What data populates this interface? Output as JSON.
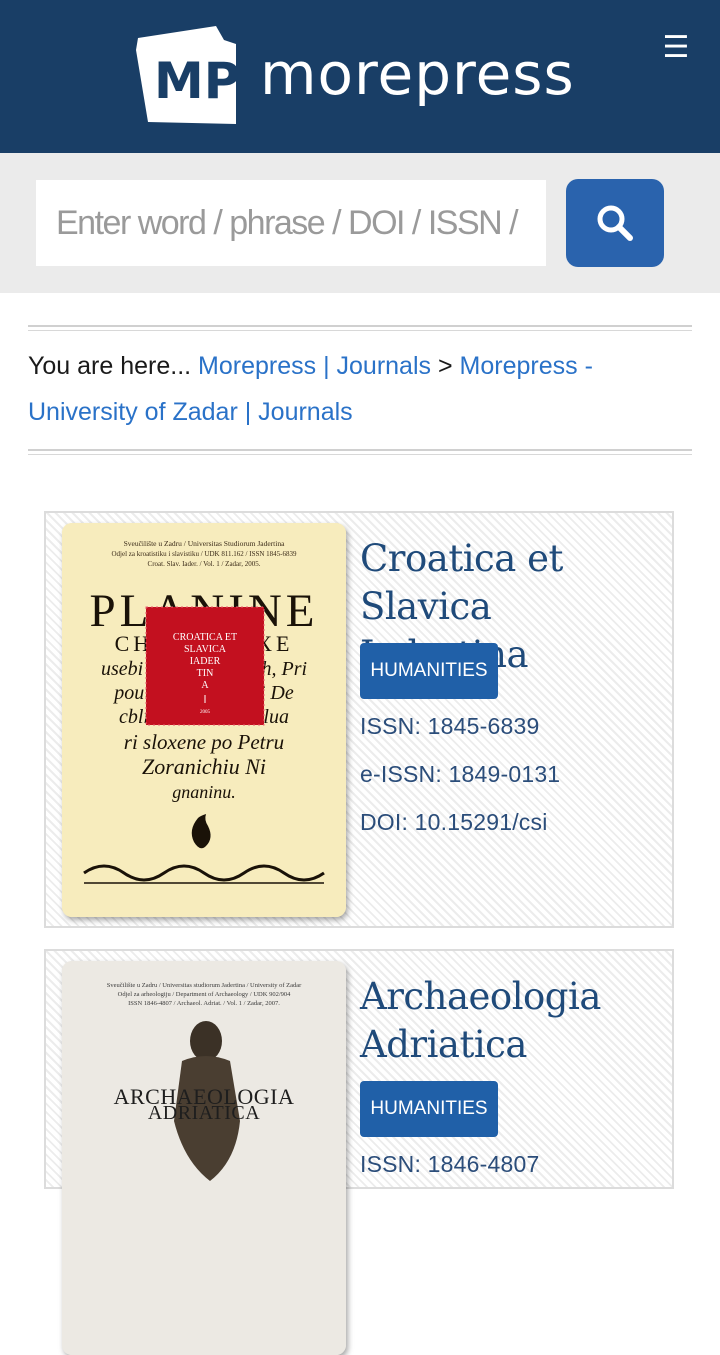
{
  "header": {
    "logo_mark_text": "MP",
    "logo_text": "morepress",
    "menu_icon": "hamburger-icon",
    "menu_glyph": "☰"
  },
  "search": {
    "placeholder": "Enter word / phrase / DOI / ISSN / author",
    "button_icon": "search-icon"
  },
  "breadcrumb": {
    "prefix": "You are here...",
    "separator": ">",
    "links": [
      {
        "label": "Morepress | Journals"
      },
      {
        "label": "Morepress - University of Zadar | Journals"
      }
    ]
  },
  "journals": [
    {
      "title": "Croatica et Slavica Iadertina",
      "tag": "HUMANITIES",
      "issn": "ISSN: 1845-6839",
      "eissn": "e-ISSN: 1849-0131",
      "doi": "DOI: 10.15291/csi",
      "cover": {
        "header_line1": "Sveučilište u Zadru / Universitas Studiorum Jadertina",
        "header_line2": "Odjel za kroatistiku i slavistiku / UDK 811.162 / ISSN 1845-6839",
        "header_line3": "Croat. Slav. Iader. / Vol. 1 / Zadar, 2005.",
        "big_word": "PLANINE",
        "line2": "CHE         XE",
        "line3": "usebi Pisni          rich, Pri",
        "line4": "pouisti, i             i i De",
        "line5": "cblic                    ilua",
        "line6": "ri sloxene po Petru",
        "line7": "Zoranichiu Ni",
        "line8": "gnaninu.",
        "red_box_line1": "CROATICA ET",
        "red_box_line2": "SLAVICA",
        "red_box_line3": "IADER",
        "red_box_line4": "TIN",
        "red_box_line5": "A",
        "red_box_year": "2005"
      }
    },
    {
      "title": "Archaeologia Adriatica",
      "tag": "HUMANITIES",
      "issn": "ISSN: 1846-4807",
      "cover": {
        "header_line1": "Sveučilište u Zadru / Universitas studiorum Jadertina / University of Zadar",
        "header_line2": "Odjel za arheologiju / Department of Archaeology / UDK 902/904",
        "header_line3": "ISSN 1846-4807 / Archaeol. Adriat. / Vol. 1 / Zadar, 2007.",
        "title_line1": "ARCHAEOLOGIA",
        "title_line2": "ADRIATICA"
      }
    }
  ],
  "colors": {
    "header_bg": "#193e66",
    "accent": "#2a63ad",
    "link": "#2a72c8",
    "tag_bg": "#2060a8",
    "title": "#1f4a7a",
    "cover_red": "#c3101f"
  }
}
